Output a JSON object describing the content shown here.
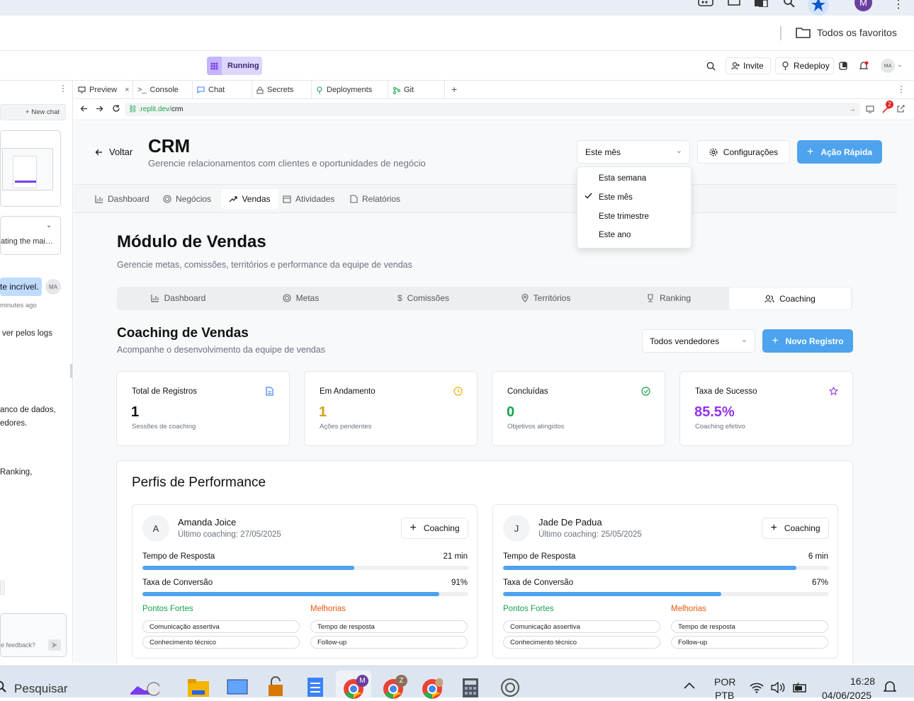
{
  "browser": {
    "profile_letter": "M",
    "bookmarks_label": "Todos os favoritos",
    "url_prefix": ".replit.dev/",
    "url_path": "crm",
    "notif_count": "2"
  },
  "replit": {
    "status": "Running",
    "invite": "Invite",
    "redeploy": "Redeploy",
    "avatar": "MA",
    "tabs": [
      "Preview",
      "Console",
      "Chat",
      "Secrets",
      "Deployments",
      "Git"
    ]
  },
  "chat_panel": {
    "new_chat": "New chat",
    "snippets": [
      "ating the mai…",
      "te incrível.",
      "minutes ago",
      "ver pelos logs",
      "anco de dados,",
      "edores.",
      "Ranking,",
      "e feedback?"
    ],
    "avatar": "MA"
  },
  "header": {
    "back": "Voltar",
    "title": "CRM",
    "subtitle": "Gerencie relacionamentos com clientes e oportunidades de negócio",
    "period_selected": "Este mês",
    "settings": "Configurações",
    "quick_action": "Ação Rápida"
  },
  "period_menu": [
    "Esta semana",
    "Este mês",
    "Este trimestre",
    "Este ano"
  ],
  "nav": [
    "Dashboard",
    "Negócios",
    "Vendas",
    "Atividades",
    "Relatórios"
  ],
  "module": {
    "title": "Módulo de Vendas",
    "subtitle": "Gerencie metas, comissões, territórios e performance da equipe de vendas",
    "tabs": [
      "Dashboard",
      "Metas",
      "Comissões",
      "Territórios",
      "Ranking",
      "Coaching"
    ]
  },
  "coaching": {
    "title": "Coaching de Vendas",
    "subtitle": "Acompanhe o desenvolvimento da equipe de vendas",
    "filter": "Todos vendedores",
    "new_record": "Novo Registro"
  },
  "stats": [
    {
      "label": "Total de Registros",
      "value": "1",
      "sub": "Sessões de coaching",
      "color": "#111111",
      "icon": "document-icon",
      "icon_color": "#3b82f6"
    },
    {
      "label": "Em Andamento",
      "value": "1",
      "sub": "Ações pendentes",
      "color": "#d4a017",
      "icon": "clock-icon",
      "icon_color": "#eab308"
    },
    {
      "label": "Concluídas",
      "value": "0",
      "sub": "Objetivos atingidos",
      "color": "#16a34a",
      "icon": "check-circle-icon",
      "icon_color": "#16a34a"
    },
    {
      "label": "Taxa de Sucesso",
      "value": "85.5%",
      "sub": "Coaching efetivo",
      "color": "#9333ea",
      "icon": "star-icon",
      "icon_color": "#9333ea"
    }
  ],
  "profiles_title": "Perfis de Performance",
  "profiles": [
    {
      "initial": "A",
      "name": "Amanda Joice",
      "last": "Último coaching: 27/05/2025",
      "button": "Coaching",
      "m1_label": "Tempo de Resposta",
      "m1_value": "21 min",
      "m1_fill": 0.65,
      "m2_label": "Taxa de Conversão",
      "m2_value": "91%",
      "m2_fill": 0.91,
      "strengths_label": "Pontos Fortes",
      "improve_label": "Melhorias",
      "strengths": [
        "Comunicação assertiva",
        "Conhecimento técnico"
      ],
      "improvements": [
        "Tempo de resposta",
        "Follow-up"
      ]
    },
    {
      "initial": "J",
      "name": "Jade De Padua",
      "last": "Último coaching: 25/05/2025",
      "button": "Coaching",
      "m1_label": "Tempo de Resposta",
      "m1_value": "6 min",
      "m1_fill": 0.9,
      "m2_label": "Taxa de Conversão",
      "m2_value": "67%",
      "m2_fill": 0.67,
      "strengths_label": "Pontos Fortes",
      "improve_label": "Melhorias",
      "strengths": [
        "Comunicação assertiva",
        "Conhecimento técnico"
      ],
      "improvements": [
        "Tempo de resposta",
        "Follow-up"
      ]
    }
  ],
  "taskbar": {
    "search": "Pesquisar",
    "lang1": "POR",
    "lang2": "PTB",
    "time": "16:28",
    "date": "04/06/2025",
    "chrome_badges": [
      "M",
      "Z"
    ]
  }
}
